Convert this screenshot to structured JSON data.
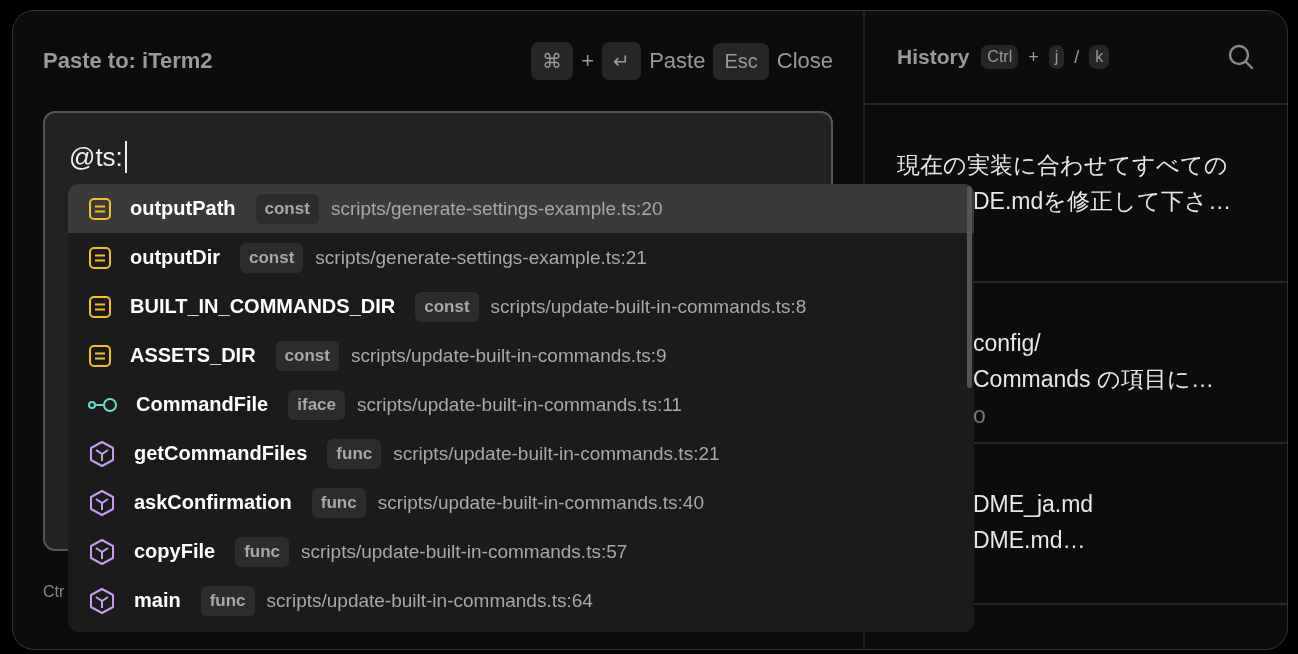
{
  "paste_pane": {
    "title": "Paste to: iTerm2",
    "shortcuts": [
      {
        "kind": "key",
        "text": "⌘"
      },
      {
        "kind": "plus",
        "text": "+"
      },
      {
        "kind": "key",
        "text": "↵"
      },
      {
        "kind": "label",
        "text": "Paste"
      },
      {
        "kind": "key",
        "text": "Esc"
      },
      {
        "kind": "label",
        "text": "Close"
      }
    ],
    "editor": {
      "value": "@ts:"
    },
    "footer_hint": "Ctr"
  },
  "completions": [
    {
      "kind": "const",
      "name": "outputPath",
      "badge": "const",
      "path": "scripts/generate-settings-example.ts:20",
      "selected": true
    },
    {
      "kind": "const",
      "name": "outputDir",
      "badge": "const",
      "path": "scripts/generate-settings-example.ts:21",
      "selected": false
    },
    {
      "kind": "const",
      "name": "BUILT_IN_COMMANDS_DIR",
      "badge": "const",
      "path": "scripts/update-built-in-commands.ts:8",
      "selected": false
    },
    {
      "kind": "const",
      "name": "ASSETS_DIR",
      "badge": "const",
      "path": "scripts/update-built-in-commands.ts:9",
      "selected": false
    },
    {
      "kind": "iface",
      "name": "CommandFile",
      "badge": "iface",
      "path": "scripts/update-built-in-commands.ts:11",
      "selected": false
    },
    {
      "kind": "func",
      "name": "getCommandFiles",
      "badge": "func",
      "path": "scripts/update-built-in-commands.ts:21",
      "selected": false
    },
    {
      "kind": "func",
      "name": "askConfirmation",
      "badge": "func",
      "path": "scripts/update-built-in-commands.ts:40",
      "selected": false
    },
    {
      "kind": "func",
      "name": "copyFile",
      "badge": "func",
      "path": "scripts/update-built-in-commands.ts:57",
      "selected": false
    },
    {
      "kind": "func",
      "name": "main",
      "badge": "func",
      "path": "scripts/update-built-in-commands.ts:64",
      "selected": false
    }
  ],
  "history": {
    "title": "History",
    "shortcuts": [
      {
        "kind": "key",
        "text": "Ctrl"
      },
      {
        "kind": "plus",
        "text": "+"
      },
      {
        "kind": "key",
        "text": "j"
      },
      {
        "kind": "plus",
        "text": "/"
      },
      {
        "kind": "key",
        "text": "k"
      }
    ],
    "items": [
      {
        "lines": [
          {
            "kind": "full",
            "text": "現在の実装に合わせてすべての"
          },
          {
            "kind": "covered",
            "text": "DE.mdを修正して下さ…"
          }
        ]
      },
      {
        "lines": [
          {
            "kind": "covered",
            "text": "config/"
          },
          {
            "kind": "covered",
            "text": "Commands の項目に…"
          },
          {
            "kind": "meta",
            "text": "o"
          }
        ]
      },
      {
        "lines": [
          {
            "kind": "covered",
            "text": "DME_ja.md"
          },
          {
            "kind": "covered",
            "text": "DME.md…"
          }
        ]
      }
    ]
  }
}
